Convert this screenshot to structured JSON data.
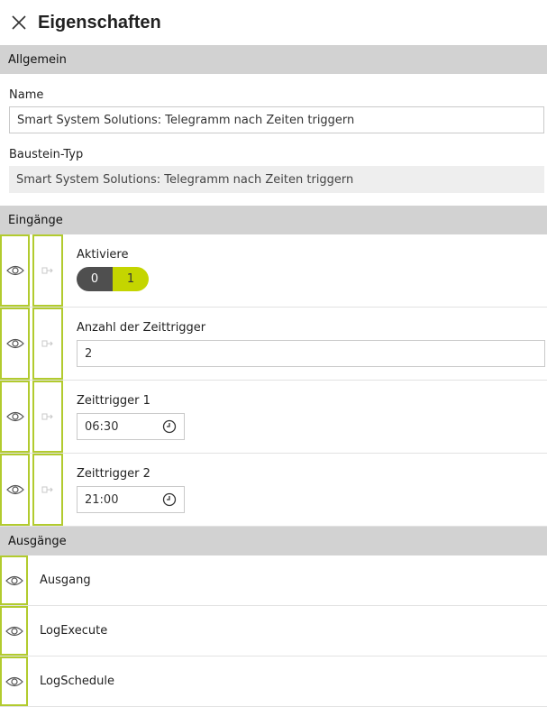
{
  "header": {
    "title": "Eigenschaften"
  },
  "general": {
    "section_title": "Allgemein",
    "name_label": "Name",
    "name_value": "Smart System Solutions: Telegramm nach Zeiten triggern",
    "type_label": "Baustein-Typ",
    "type_value": "Smart System Solutions: Telegramm nach Zeiten triggern"
  },
  "inputs": {
    "section_title": "Eingänge",
    "activate": {
      "label": "Aktiviere",
      "off": "0",
      "on": "1"
    },
    "count": {
      "label": "Anzahl der Zeittrigger",
      "value": "2"
    },
    "trigger1": {
      "label": "Zeittrigger 1",
      "value": "06:30"
    },
    "trigger2": {
      "label": "Zeittrigger 2",
      "value": "21:00"
    }
  },
  "outputs": {
    "section_title": "Ausgänge",
    "items": [
      {
        "label": "Ausgang"
      },
      {
        "label": "LogExecute"
      },
      {
        "label": "LogSchedule"
      }
    ]
  },
  "colors": {
    "accent": "#b2cb2e",
    "toggle_on": "#c4d500",
    "toggle_off": "#4f4f4f",
    "section_bg": "#d2d2d2"
  }
}
